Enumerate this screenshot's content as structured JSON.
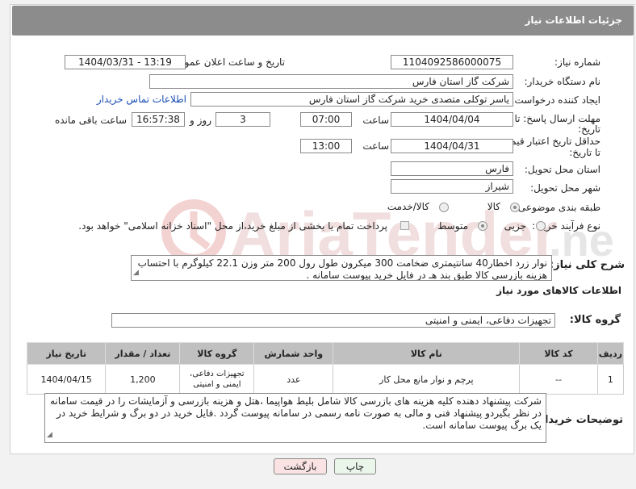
{
  "header": {
    "title": "جزئیات اطلاعات نیاز"
  },
  "fields": {
    "need_number": {
      "label": "شماره نیاز:",
      "value": "1104092586000075"
    },
    "announce": {
      "label": "تاریخ و ساعت اعلان عمومی:",
      "value": "1404/03/31 - 13:19"
    },
    "buyer_org": {
      "label": "نام دستگاه خریدار:",
      "value": "شرکت گاز استان فارس"
    },
    "creator": {
      "label": "ایجاد کننده درخواست:",
      "value": "یاسر توکلی متصدی خرید شرکت گاز استان فارس",
      "link": "اطلاعات تماس خریدار"
    },
    "deadline": {
      "label1": "مهلت ارسال پاسخ: تا",
      "label2": "تاریخ:",
      "date": "1404/04/04",
      "time_label": "ساعت",
      "time": "07:00",
      "days": "3",
      "days_label": "روز و",
      "remaining": "16:57:38",
      "remaining_label": "ساعت باقی مانده"
    },
    "validity": {
      "label1": "حداقل تاریخ اعتبار قیمت:",
      "label2": "تا تاریخ:",
      "date": "1404/04/31",
      "time_label": "ساعت",
      "time": "13:00"
    },
    "province": {
      "label": "استان محل تحویل:",
      "value": "فارس"
    },
    "city": {
      "label": "شهر محل تحویل:",
      "value": "شیراز"
    },
    "category": {
      "label": "طبقه بندی موضوعی:",
      "options": [
        "کالا",
        "کالا/خدمت"
      ]
    },
    "process": {
      "label": "نوع فرآیند خرید :",
      "options": [
        "جزیی",
        "متوسط"
      ],
      "payment_note": "پرداخت تمام یا بخشی از مبلغ خرید،از محل \"اسناد خزانه اسلامی\" خواهد بود."
    }
  },
  "description": {
    "label": "شرح کلی نیاز:",
    "text": "نوار زرد اخطار40 سانتیمتری ضخامت  300 میکرون طول رول 200 متر وزن 22.1 کیلوگرم با احتساب هزینه بازرسی کالا طبق بند هـ در فایل خرید پیوست سامانه ."
  },
  "goods_info": {
    "title": "اطلاعات کالاهای مورد نیاز",
    "group_label": "گروه کالا:",
    "group_value": "تجهیزات دفاعی، ایمنی و امنیتی"
  },
  "table": {
    "headers": [
      "ردیف",
      "کد کالا",
      "نام کالا",
      "واحد شمارش",
      "گروه کالا",
      "تعداد / مقدار",
      "تاریخ نیاز"
    ],
    "rows": [
      {
        "row": "1",
        "code": "--",
        "name": "پرچم و نوار مانع محل کار",
        "unit": "عدد",
        "group": "تجهیزات دفاعی، ایمنی و امنیتی",
        "qty": "1,200",
        "date": "1404/04/15"
      }
    ]
  },
  "buyer_notes": {
    "label": "توضیحات خریدار:",
    "text": "شرکت پیشنهاد دهنده کلیه هزینه های بازرسی کالا شامل بلیط هواپیما ،هتل و هزینه بازرسی و آزمایشات را در قیمت سامانه در نظر بگیردو پیشنهاد فنی و مالی به صورت نامه رسمی در سامانه پیوست گردد .فایل خرید در دو برگ و شرایط خرید در یک برگ پیوست سامانه است."
  },
  "buttons": {
    "print": "چاپ",
    "back": "بازگشت"
  }
}
